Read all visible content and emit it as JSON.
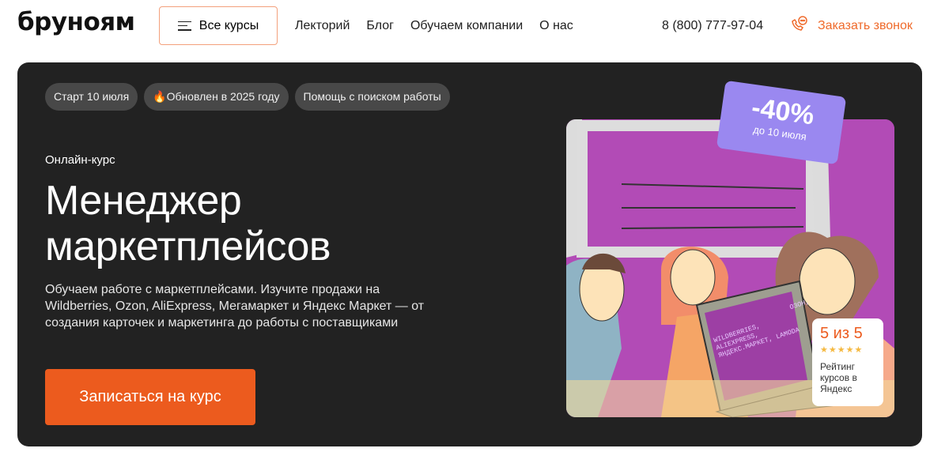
{
  "header": {
    "logo": "бруноям",
    "all_courses": "Все курсы",
    "nav": [
      "Лекторий",
      "Блог",
      "Обучаем компании",
      "О нас"
    ],
    "phone": "8 (800) 777-97-04",
    "callback": "Заказать звонок"
  },
  "hero": {
    "tags": [
      "Старт 10 июля",
      "🔥Обновлен в 2025 году",
      "Помощь с поиском работы"
    ],
    "kicker": "Онлайн-курс",
    "title_line1": "Менеджер",
    "title_line2": "маркетплейсов",
    "description": "Обучаем работе с маркетплейсами. Изучите продажи на Wildberries, Ozon, AliExpress, Мегамаркет и Яндекс Маркет — от создания карточек и маркетинга до работы с поставщиками",
    "cta": "Записаться на курс",
    "discount": {
      "value": "-40%",
      "until": "до 10 июля"
    },
    "laptop_text": {
      "line1": "ОЗОН,",
      "line2": "WILDBERRIES,",
      "line3": "ALIEXPRESS,",
      "line4": "ЯНДЕКС.МАРКЕТ, LAMODA"
    },
    "rating": {
      "score": "5 из 5",
      "stars": "★★★★★",
      "label": "Рейтинг курсов в Яндекс"
    }
  },
  "colors": {
    "accent": "#ec5b1e",
    "hero_bg": "#222222",
    "badge": "#9a88f0",
    "illustration": "#b24bb6"
  }
}
